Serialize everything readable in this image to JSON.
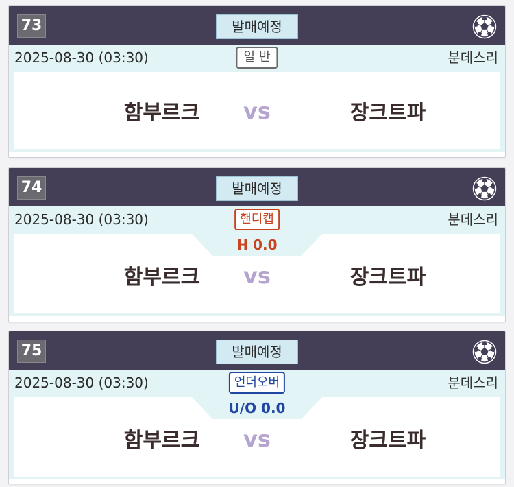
{
  "matches": [
    {
      "number": "73",
      "status": "발매예정",
      "date": "2025-08-30 (03:30)",
      "bet_type": "일반",
      "league": "분데스리",
      "home_team": "함부르크",
      "vs": "vs",
      "away_team": "장크트파",
      "handicap_text": ""
    },
    {
      "number": "74",
      "status": "발매예정",
      "date": "2025-08-30 (03:30)",
      "bet_type": "핸디캡",
      "league": "분데스리",
      "home_team": "함부르크",
      "vs": "vs",
      "away_team": "장크트파",
      "handicap_text": "H 0.0"
    },
    {
      "number": "75",
      "status": "발매예정",
      "date": "2025-08-30 (03:30)",
      "bet_type": "언더오버",
      "league": "분데스리",
      "home_team": "함부르크",
      "vs": "vs",
      "away_team": "장크트파",
      "handicap_text": "U/O 0.0"
    }
  ],
  "icons": {
    "sport": "soccer-ball-icon"
  },
  "colors": {
    "header_bg": "#443e57",
    "status_bg": "#d4eaf3",
    "info_bg": "#e3f4f6",
    "handicap": "#c9431f",
    "under_over": "#1f46a0",
    "vs": "#b4a4cf",
    "team": "#3a2c2c"
  }
}
